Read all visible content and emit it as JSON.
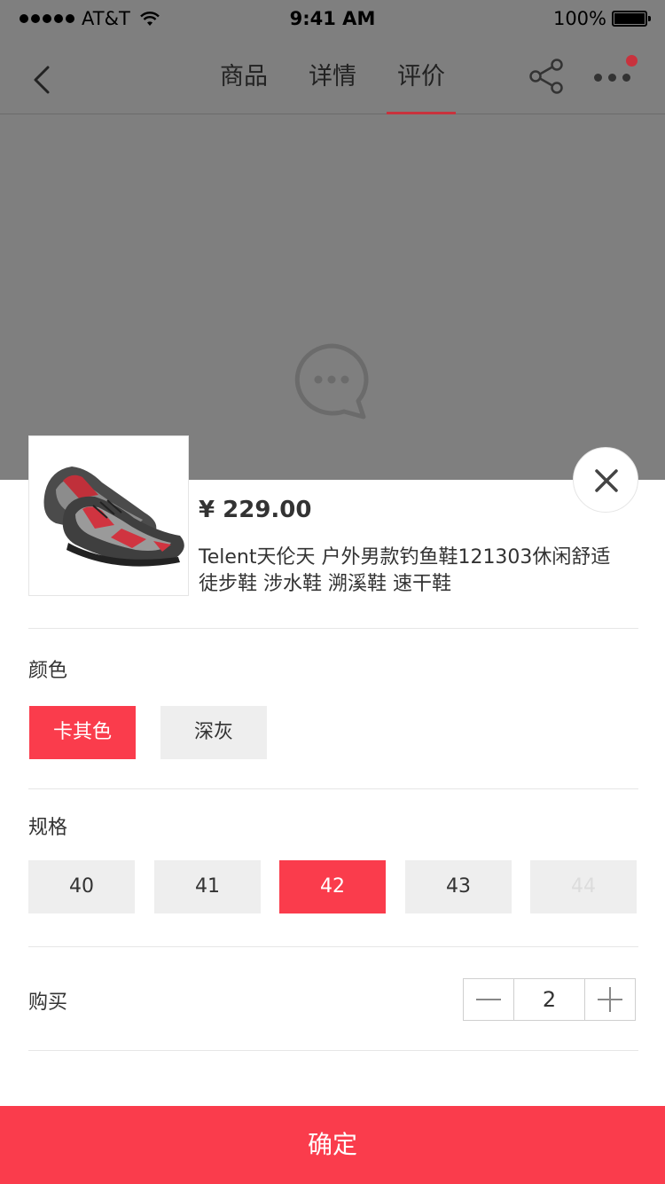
{
  "status_bar": {
    "carrier": "AT&T",
    "time": "9:41 AM",
    "battery": "100%"
  },
  "nav": {
    "tabs": [
      {
        "label": "商品",
        "active": false
      },
      {
        "label": "详情",
        "active": false
      },
      {
        "label": "评价",
        "active": true
      }
    ],
    "has_notification_badge": true
  },
  "product": {
    "price": "¥ 229.00",
    "title": "Telent天伦天 户外男款钓鱼鞋121303休闲舒适徒步鞋 涉水鞋 溯溪鞋 速干鞋"
  },
  "color_section": {
    "label": "颜色",
    "options": [
      {
        "label": "卡其色",
        "state": "selected"
      },
      {
        "label": "深灰",
        "state": "normal"
      }
    ]
  },
  "size_section": {
    "label": "规格",
    "options": [
      {
        "label": "40",
        "state": "normal"
      },
      {
        "label": "41",
        "state": "normal"
      },
      {
        "label": "42",
        "state": "selected"
      },
      {
        "label": "43",
        "state": "normal"
      },
      {
        "label": "44",
        "state": "disabled"
      }
    ]
  },
  "quantity_section": {
    "label": "购买",
    "value": "2"
  },
  "confirm_label": "确定",
  "colors": {
    "accent": "#fa3c4c",
    "tab_underline": "#c8323d",
    "overlay": "#7f7f7f"
  },
  "icons": [
    "back-icon",
    "share-icon",
    "more-icon",
    "chat-bubble-icon",
    "close-icon",
    "minus-icon",
    "plus-icon"
  ]
}
